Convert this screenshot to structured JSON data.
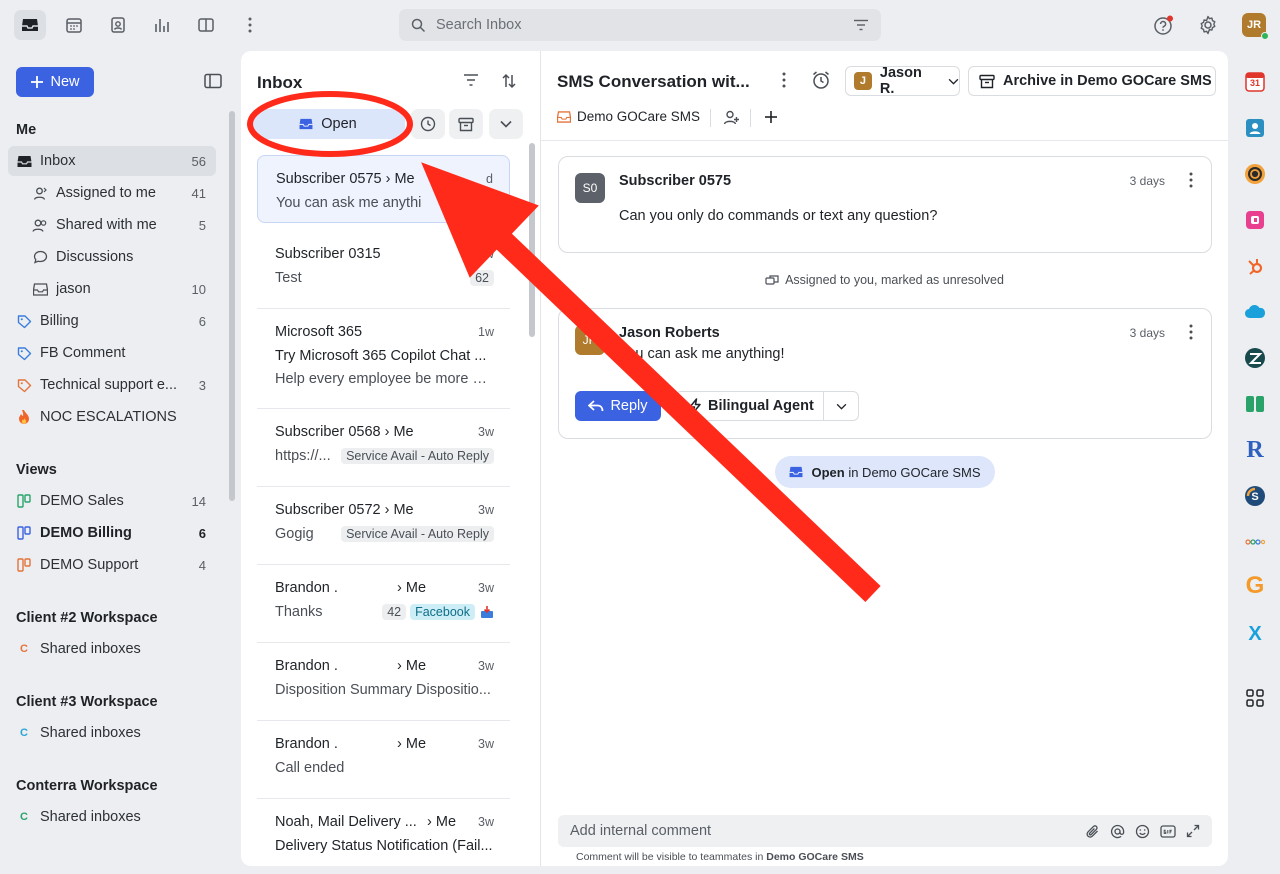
{
  "search": {
    "placeholder": "Search Inbox"
  },
  "user": {
    "initials": "JR"
  },
  "sidebar": {
    "new_label": "New",
    "me_heading": "Me",
    "items": [
      {
        "label": "Inbox",
        "count": "56"
      },
      {
        "label": "Assigned to me",
        "count": "41"
      },
      {
        "label": "Shared with me",
        "count": "5"
      },
      {
        "label": "Discussions",
        "count": ""
      },
      {
        "label": "jason",
        "count": "10"
      },
      {
        "label": "Billing",
        "count": "6"
      },
      {
        "label": "FB Comment",
        "count": ""
      },
      {
        "label": "Technical support e...",
        "count": "3"
      },
      {
        "label": "NOC ESCALATIONS",
        "count": ""
      }
    ],
    "views_heading": "Views",
    "views": [
      {
        "label": "DEMO Sales",
        "count": "14"
      },
      {
        "label": "DEMO Billing",
        "count": "6"
      },
      {
        "label": "DEMO Support",
        "count": "4"
      }
    ],
    "workspaces": [
      {
        "heading": "Client #2 Workspace",
        "item": "Shared inboxes",
        "badge": "C"
      },
      {
        "heading": "Client #3 Workspace",
        "item": "Shared inboxes",
        "badge": "C"
      },
      {
        "heading": "Conterra Workspace",
        "item": "Shared inboxes",
        "badge": "C"
      }
    ]
  },
  "list": {
    "title": "Inbox",
    "open_label": "Open",
    "conversations": [
      {
        "who": "Subscriber 0575",
        "me": "Me",
        "time": "d",
        "snippet": "You can ask me anythi"
      },
      {
        "who": "Subscriber 0315",
        "me": "",
        "time": "1w",
        "snippet": "Test",
        "tag": "62"
      },
      {
        "who": "Microsoft 365",
        "me": "",
        "time": "1w",
        "snippet": "Try Microsoft 365 Copilot Chat ...",
        "line3": "Help every employee be more pr..."
      },
      {
        "who": "Subscriber 0568",
        "me": "Me",
        "time": "3w",
        "snippet": "https://...",
        "tag": "Service Avail - Auto Reply"
      },
      {
        "who": "Subscriber 0572",
        "me": "Me",
        "time": "3w",
        "snippet": "Gogig",
        "tag": "Service Avail - Auto Reply"
      },
      {
        "who": "Brandon .",
        "me": "Me",
        "time": "3w",
        "snippet": "Thanks",
        "tag": "42",
        "tag2": "Facebook"
      },
      {
        "who": "Brandon .",
        "me": "Me",
        "time": "3w",
        "snippet": "Disposition Summary Dispositio..."
      },
      {
        "who": "Brandon .",
        "me": "Me",
        "time": "3w",
        "snippet": "Call ended"
      },
      {
        "who": "Noah, Mail Delivery ...",
        "me": "Me",
        "time": "3w",
        "snippet": "Delivery Status Notification (Fail..."
      }
    ]
  },
  "conversation": {
    "title": "SMS Conversation wit...",
    "assignee_initial": "J",
    "assignee_name": "Jason R.",
    "archive_label": "Archive in Demo GOCare SMS",
    "inbox_name": "Demo GOCare SMS",
    "messages": [
      {
        "initials": "S0",
        "name": "Subscriber 0575",
        "time": "3 days",
        "body": "Can you only do commands or text any question?"
      },
      {
        "initials": "JR",
        "name": "Jason Roberts",
        "time": "3 days",
        "body": "You can ask me anything!"
      }
    ],
    "event_text": "Assigned to you, marked as unresolved",
    "reply_label": "Reply",
    "agent_label": "Bilingual Agent",
    "status_bold": "Open",
    "status_rest": "in Demo GOCare SMS",
    "comment_placeholder": "Add internal comment",
    "comment_note_prefix": "Comment will be visible to teammates in ",
    "comment_note_inbox": "Demo GOCare SMS"
  },
  "rail": {
    "calendar_day": "31",
    "r_letter": "R",
    "g_letter": "G",
    "x_letter": "X"
  },
  "colors": {
    "accent": "#3b62e0",
    "annotation": "#ff2a1a"
  }
}
